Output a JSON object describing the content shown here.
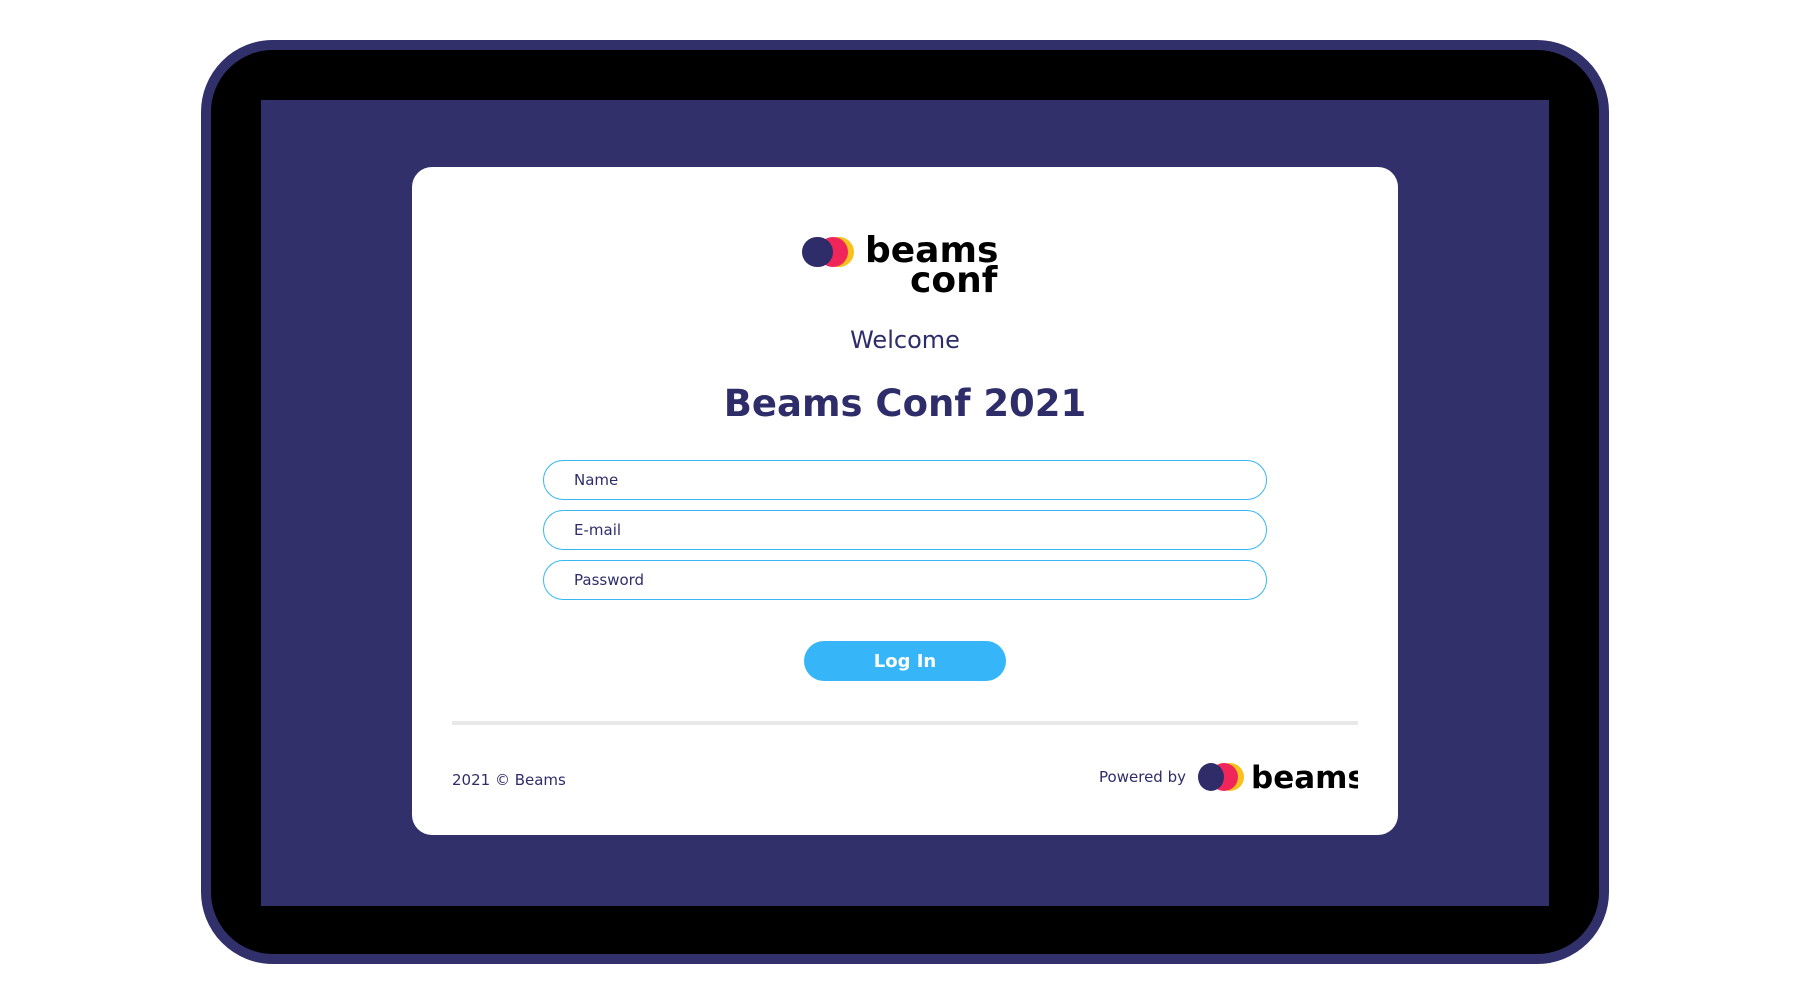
{
  "app": {
    "logo": {
      "primary_word": "beams",
      "secondary_word": "conf"
    },
    "welcome": "Welcome",
    "title": "Beams Conf 2021"
  },
  "form": {
    "name_placeholder": "Name",
    "email_placeholder": "E-mail",
    "password_placeholder": "Password",
    "login_label": "Log In"
  },
  "footer": {
    "copyright": "2021 © Beams",
    "powered_by": "Powered by",
    "brand": "beams"
  },
  "colors": {
    "frame": "#31306a",
    "text": "#2e2d6a",
    "accent": "#36b6f8",
    "logo_red": "#f0265a",
    "logo_yellow": "#f7c21b"
  }
}
